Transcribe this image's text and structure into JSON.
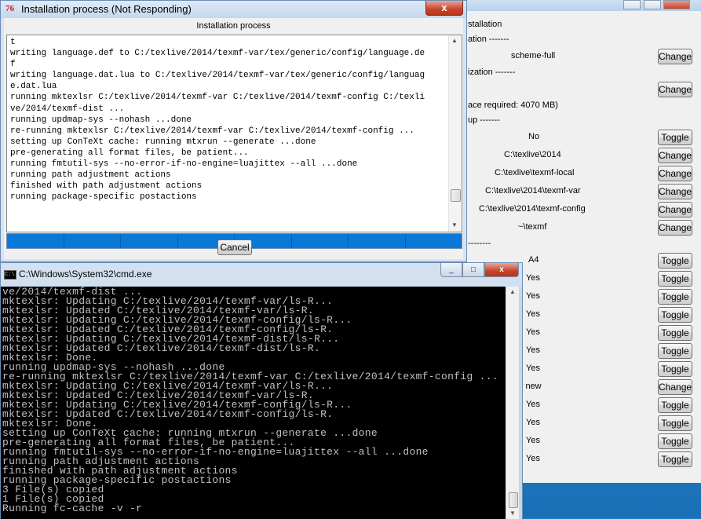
{
  "bg_window": {
    "rows": [
      {
        "label": "stallation",
        "button": ""
      },
      {
        "label": "ation -------",
        "button": ""
      },
      {
        "label": "scheme-full",
        "button": "Change"
      },
      {
        "label": "ization -------",
        "button": ""
      },
      {
        "label": "",
        "button": "Change"
      },
      {
        "label": "ace required: 4070 MB)",
        "button": ""
      },
      {
        "label": "up -------",
        "button": ""
      },
      {
        "label": "No",
        "button": "Toggle"
      },
      {
        "label": "C:\\texlive\\2014",
        "button": "Change"
      },
      {
        "label": "C:\\texlive\\texmf-local",
        "button": "Change"
      },
      {
        "label": "C:\\texlive\\2014\\texmf-var",
        "button": "Change"
      },
      {
        "label": "C:\\texlive\\2014\\texmf-config",
        "button": "Change"
      },
      {
        "label": "~\\texmf",
        "button": "Change"
      },
      {
        "label": "--------",
        "button": ""
      },
      {
        "label": "A4",
        "button": "Toggle"
      },
      {
        "label": "Yes",
        "button": "Toggle"
      },
      {
        "label": "Yes",
        "button": "Toggle"
      },
      {
        "label": "Yes",
        "button": "Toggle"
      },
      {
        "label": "Yes",
        "button": "Toggle"
      },
      {
        "label": "Yes",
        "button": "Toggle"
      },
      {
        "label": "Yes",
        "button": "Toggle"
      },
      {
        "label": "lly new",
        "button": "Change"
      },
      {
        "label": "Yes",
        "button": "Toggle"
      },
      {
        "label": "Yes",
        "button": "Toggle"
      },
      {
        "label": "Yes",
        "button": "Toggle"
      },
      {
        "label": "Yes",
        "button": "Toggle"
      }
    ]
  },
  "install_window": {
    "title": "Installation process (Not Responding)",
    "icon": "tex-live-icon",
    "header": "Installation process",
    "log": "t\nwriting language.def to C:/texlive/2014/texmf-var/tex/generic/config/language.de\nf\nwriting language.dat.lua to C:/texlive/2014/texmf-var/tex/generic/config/languag\ne.dat.lua\nrunning mktexlsr C:/texlive/2014/texmf-var C:/texlive/2014/texmf-config C:/texli\nve/2014/texmf-dist ...\nrunning updmap-sys --nohash ...done\nre-running mktexlsr C:/texlive/2014/texmf-var C:/texlive/2014/texmf-config ...\nsetting up ConTeXt cache: running mtxrun --generate ...done\npre-generating all format files, be patient...\nrunning fmtutil-sys --no-error-if-no-engine=luajittex --all ...done\nrunning path adjustment actions\nfinished with path adjustment actions\nrunning package-specific postactions",
    "progress_percent": 100,
    "cancel_label": "Cancel",
    "close_glyph": "x"
  },
  "cmd_window": {
    "title": "C:\\Windows\\System32\\cmd.exe",
    "icon_text": "C:\\",
    "minimize_glyph": "_",
    "maximize_glyph": "□",
    "close_glyph": "x",
    "console": "ve/2014/texmf-dist ...\nmktexlsr: Updating C:/texlive/2014/texmf-var/ls-R...\nmktexlsr: Updated C:/texlive/2014/texmf-var/ls-R.\nmktexlsr: Updating C:/texlive/2014/texmf-config/ls-R...\nmktexlsr: Updated C:/texlive/2014/texmf-config/ls-R.\nmktexlsr: Updating C:/texlive/2014/texmf-dist/ls-R...\nmktexlsr: Updated C:/texlive/2014/texmf-dist/ls-R.\nmktexlsr: Done.\nrunning updmap-sys --nohash ...done\nre-running mktexlsr C:/texlive/2014/texmf-var C:/texlive/2014/texmf-config ...\nmktexlsr: Updating C:/texlive/2014/texmf-var/ls-R...\nmktexlsr: Updated C:/texlive/2014/texmf-var/ls-R.\nmktexlsr: Updating C:/texlive/2014/texmf-config/ls-R...\nmktexlsr: Updated C:/texlive/2014/texmf-config/ls-R.\nmktexlsr: Done.\nsetting up ConTeXt cache: running mtxrun --generate ...done\npre-generating all format files, be patient...\nrunning fmtutil-sys --no-error-if-no-engine=luajittex --all ...done\nrunning path adjustment actions\nfinished with path adjustment actions\nrunning package-specific postactions\n3 File(s) copied\n1 File(s) copied\nRunning fc-cache -v -r"
  }
}
